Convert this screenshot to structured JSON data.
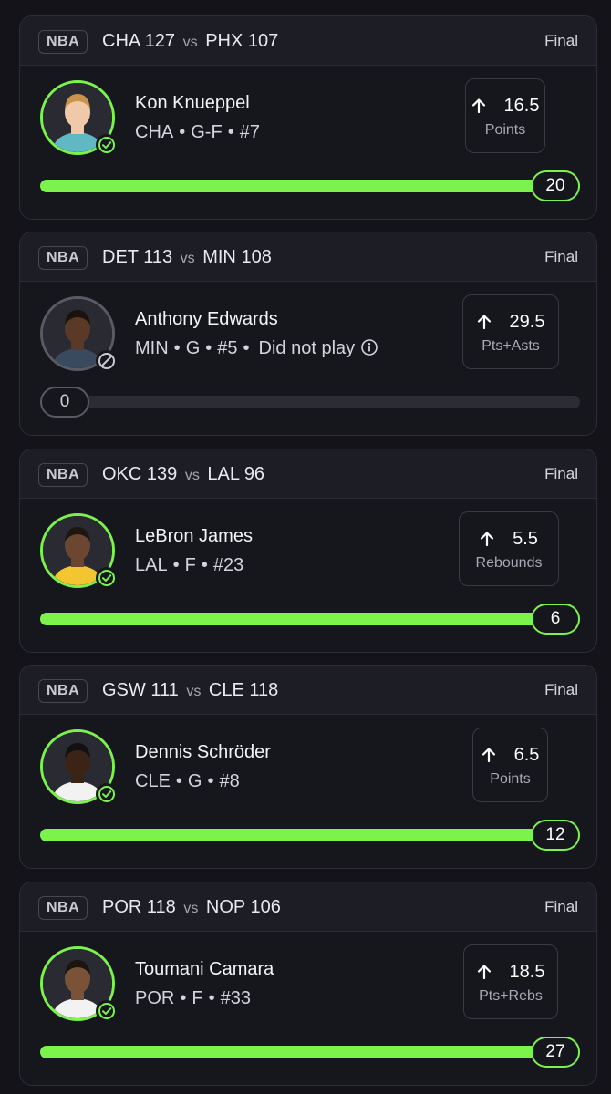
{
  "colors": {
    "accent": "#7cf24c",
    "background": "#131319",
    "card": "#16161d",
    "muted": "#5a5a64"
  },
  "cards": [
    {
      "league": "NBA",
      "team1": "CHA",
      "score1": "127",
      "vs": "vs",
      "team2": "PHX",
      "score2": "107",
      "status": "Final",
      "player": {
        "name": "Kon Knueppel",
        "team": "CHA",
        "position": "G-F",
        "number": "#7",
        "note": "",
        "avatar_icon": "player-photo",
        "badge_icon": "check-circle-icon"
      },
      "line": {
        "value": "16.5",
        "direction": "up-arrow-icon",
        "stat": "Points"
      },
      "result": {
        "value": "20",
        "progress": 1.0,
        "hit": true
      }
    },
    {
      "league": "NBA",
      "team1": "DET",
      "score1": "113",
      "vs": "vs",
      "team2": "MIN",
      "score2": "108",
      "status": "Final",
      "player": {
        "name": "Anthony Edwards",
        "team": "MIN",
        "position": "G",
        "number": "#5",
        "note": "Did not play",
        "avatar_icon": "player-photo",
        "badge_icon": "slash-circle-icon"
      },
      "line": {
        "value": "29.5",
        "direction": "up-arrow-icon",
        "stat": "Pts+Asts"
      },
      "result": {
        "value": "0",
        "progress": 0.0,
        "hit": false
      }
    },
    {
      "league": "NBA",
      "team1": "OKC",
      "score1": "139",
      "vs": "vs",
      "team2": "LAL",
      "score2": "96",
      "status": "Final",
      "player": {
        "name": "LeBron James",
        "team": "LAL",
        "position": "F",
        "number": "#23",
        "note": "",
        "avatar_icon": "player-photo",
        "badge_icon": "check-circle-icon"
      },
      "line": {
        "value": "5.5",
        "direction": "up-arrow-icon",
        "stat": "Rebounds"
      },
      "result": {
        "value": "6",
        "progress": 1.0,
        "hit": true
      }
    },
    {
      "league": "NBA",
      "team1": "GSW",
      "score1": "111",
      "vs": "vs",
      "team2": "CLE",
      "score2": "118",
      "status": "Final",
      "player": {
        "name": "Dennis Schröder",
        "team": "CLE",
        "position": "G",
        "number": "#8",
        "note": "",
        "avatar_icon": "player-photo",
        "badge_icon": "check-circle-icon"
      },
      "line": {
        "value": "6.5",
        "direction": "up-arrow-icon",
        "stat": "Points"
      },
      "result": {
        "value": "12",
        "progress": 1.0,
        "hit": true
      }
    },
    {
      "league": "NBA",
      "team1": "POR",
      "score1": "118",
      "vs": "vs",
      "team2": "NOP",
      "score2": "106",
      "status": "Final",
      "player": {
        "name": "Toumani Camara",
        "team": "POR",
        "position": "F",
        "number": "#33",
        "note": "",
        "avatar_icon": "player-photo",
        "badge_icon": "check-circle-icon"
      },
      "line": {
        "value": "18.5",
        "direction": "up-arrow-icon",
        "stat": "Pts+Rebs"
      },
      "result": {
        "value": "27",
        "progress": 1.0,
        "hit": true
      }
    }
  ]
}
